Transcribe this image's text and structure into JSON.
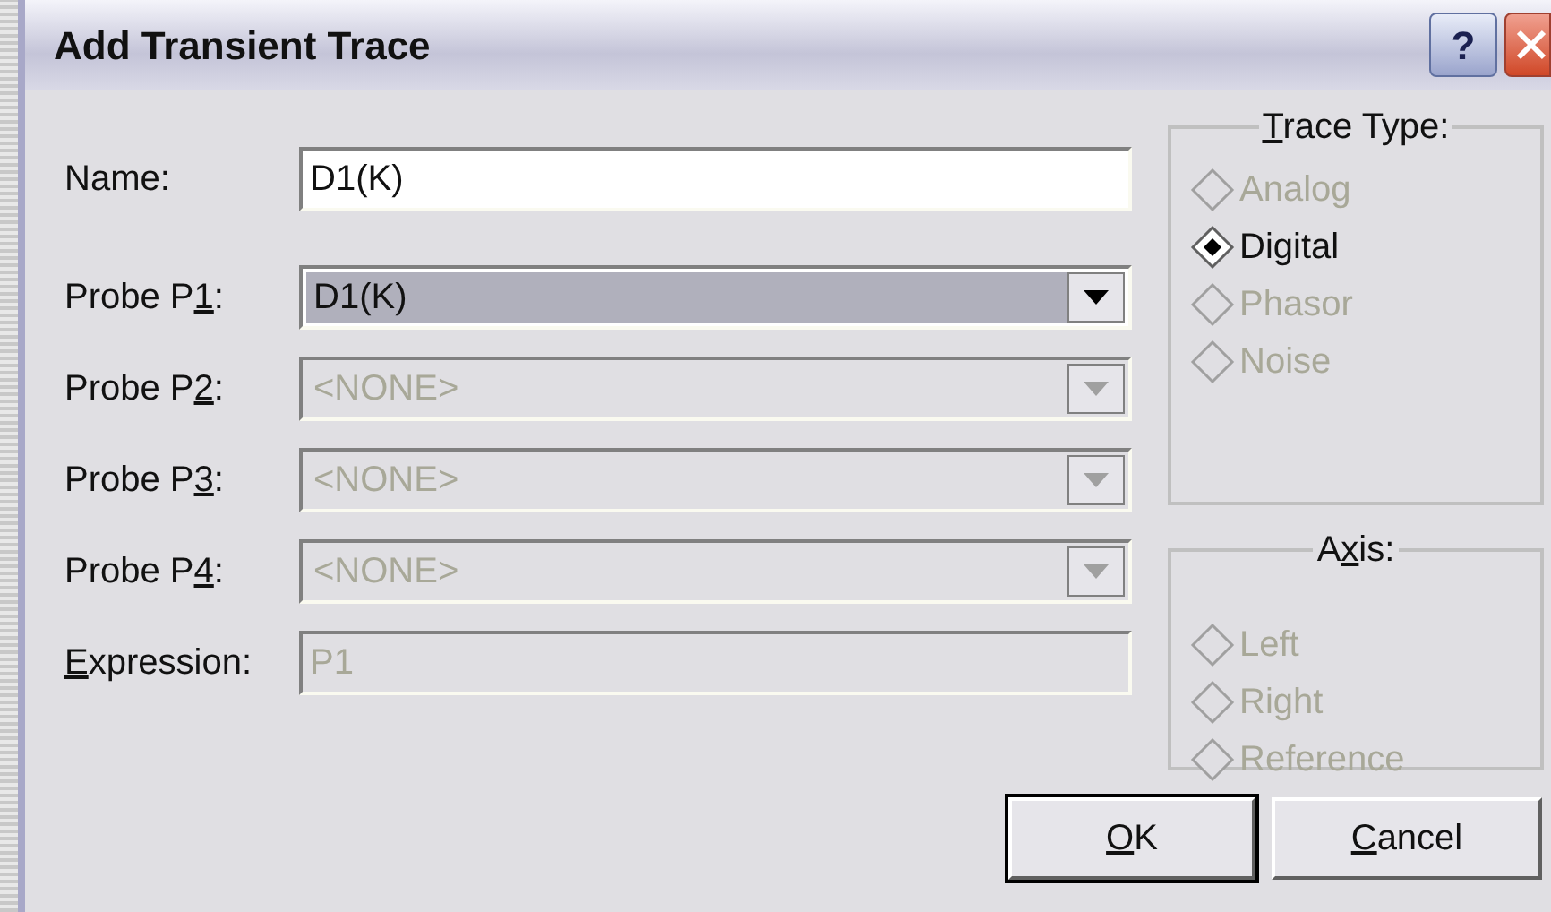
{
  "window": {
    "title": "Add Transient Trace"
  },
  "title_buttons": [
    {
      "kind": "help",
      "label": "?"
    },
    {
      "kind": "close"
    }
  ],
  "fields": [
    {
      "kind": "text",
      "label": [
        {
          "text": "Name:",
          "underline": false
        }
      ],
      "value": "D1(K)",
      "disabled": false
    },
    {
      "kind": "combo",
      "label": [
        {
          "text": "Probe P",
          "underline": false
        },
        {
          "text": "1",
          "underline": true
        },
        {
          "text": ":",
          "underline": false
        }
      ],
      "value": "D1(K)",
      "disabled": false,
      "focused": true
    },
    {
      "kind": "combo",
      "label": [
        {
          "text": "Probe P",
          "underline": false
        },
        {
          "text": "2",
          "underline": true
        },
        {
          "text": ":",
          "underline": false
        }
      ],
      "value": "<NONE>",
      "disabled": true,
      "focused": false
    },
    {
      "kind": "combo",
      "label": [
        {
          "text": "Probe P",
          "underline": false
        },
        {
          "text": "3",
          "underline": true
        },
        {
          "text": ":",
          "underline": false
        }
      ],
      "value": "<NONE>",
      "disabled": true,
      "focused": false
    },
    {
      "kind": "combo",
      "label": [
        {
          "text": "Probe P",
          "underline": false
        },
        {
          "text": "4",
          "underline": true
        },
        {
          "text": ":",
          "underline": false
        }
      ],
      "value": "<NONE>",
      "disabled": true,
      "focused": false
    },
    {
      "kind": "text",
      "label": [
        {
          "text": "E",
          "underline": true
        },
        {
          "text": "xpression:",
          "underline": false
        }
      ],
      "value": "P1",
      "disabled": true
    }
  ],
  "groups": [
    {
      "title": [
        {
          "text": "T",
          "underline": true
        },
        {
          "text": "race Type:",
          "underline": false
        }
      ],
      "options": [
        {
          "label": "Analog",
          "selected": false,
          "disabled": true
        },
        {
          "label": "Digital",
          "selected": true,
          "disabled": false
        },
        {
          "label": "Phasor",
          "selected": false,
          "disabled": true
        },
        {
          "label": "Noise",
          "selected": false,
          "disabled": true
        }
      ]
    },
    {
      "title": [
        {
          "text": "A",
          "underline": false
        },
        {
          "text": "x",
          "underline": true
        },
        {
          "text": "is:",
          "underline": false
        }
      ],
      "options": [
        {
          "label": "Left",
          "selected": false,
          "disabled": true
        },
        {
          "label": "Right",
          "selected": false,
          "disabled": true
        },
        {
          "label": "Reference",
          "selected": false,
          "disabled": true
        }
      ]
    }
  ],
  "buttons": [
    {
      "label": [
        {
          "text": "O",
          "underline": true
        },
        {
          "text": "K",
          "underline": false
        }
      ],
      "default": true
    },
    {
      "label": [
        {
          "text": "C",
          "underline": true
        },
        {
          "text": "ancel",
          "underline": false
        }
      ],
      "default": false
    }
  ]
}
